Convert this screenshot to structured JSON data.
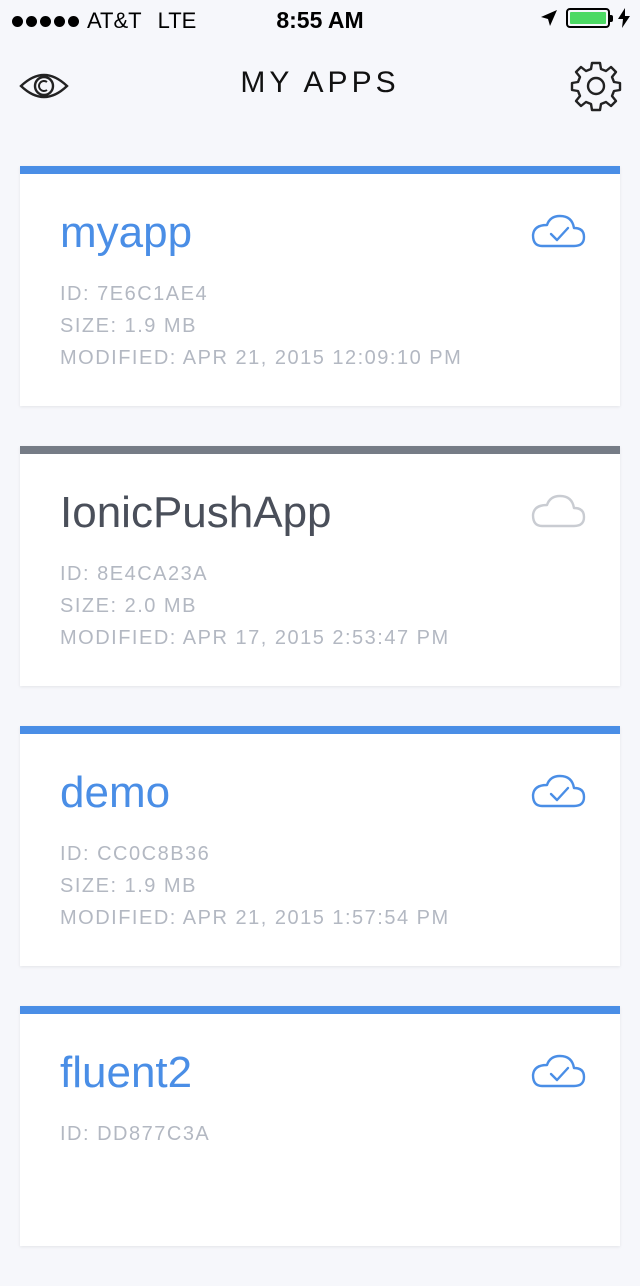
{
  "status_bar": {
    "carrier": "AT&T",
    "network": "LTE",
    "time": "8:55 AM",
    "battery_color": "#4cd964"
  },
  "nav": {
    "title": "MY APPS",
    "left_icon": "eye-icon",
    "right_icon": "gear-icon"
  },
  "colors": {
    "accent_active": "#4a8ee6",
    "accent_inactive": "#767c86",
    "name_active": "#4a8ee6",
    "name_inactive": "#4a4f5a"
  },
  "apps": [
    {
      "name": "myapp",
      "id": "ID: 7E6C1AE4",
      "size": "SIZE: 1.9 MB",
      "modified": "MODIFIED: APR 21, 2015 12:09:10 PM",
      "synced": true,
      "icon": "cloud-check-icon"
    },
    {
      "name": "IonicPushApp",
      "id": "ID: 8E4CA23A",
      "size": "SIZE: 2.0 MB",
      "modified": "MODIFIED: APR 17, 2015 2:53:47 PM",
      "synced": false,
      "icon": "cloud-icon"
    },
    {
      "name": "demo",
      "id": "ID: CC0C8B36",
      "size": "SIZE: 1.9 MB",
      "modified": "MODIFIED: APR 21, 2015 1:57:54 PM",
      "synced": true,
      "icon": "cloud-check-icon"
    },
    {
      "name": "fluent2",
      "id": "ID: DD877C3A",
      "size": "",
      "modified": "",
      "synced": true,
      "icon": "cloud-check-icon"
    }
  ]
}
